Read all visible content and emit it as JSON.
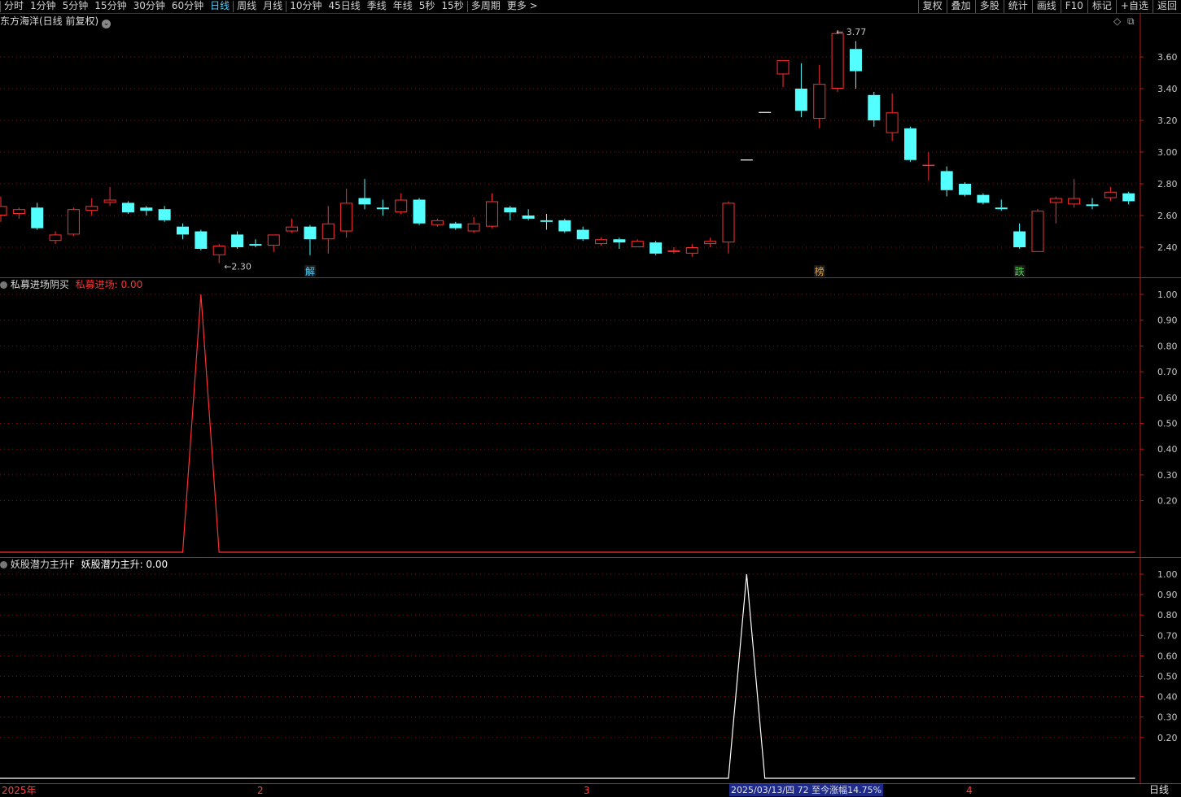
{
  "toolbar": {
    "periods": [
      {
        "label": "分时"
      },
      {
        "label": "1分钟"
      },
      {
        "label": "5分钟"
      },
      {
        "label": "15分钟"
      },
      {
        "label": "30分钟"
      },
      {
        "label": "60分钟"
      },
      {
        "label": "日线",
        "active": true
      },
      {
        "label": "周线"
      },
      {
        "label": "月线"
      },
      {
        "label": "10分钟"
      },
      {
        "label": "45日线"
      },
      {
        "label": "季线"
      },
      {
        "label": "年线"
      },
      {
        "label": "5秒"
      },
      {
        "label": "15秒"
      },
      {
        "label": "多周期"
      },
      {
        "label": "更多 >"
      }
    ],
    "tools": [
      "复权",
      "叠加",
      "多股",
      "统计",
      "画线",
      "F10",
      "标记",
      "+自选",
      "返回"
    ]
  },
  "main_chart": {
    "title": "东方海洋(日线 前复权)",
    "high_label": "3.77",
    "low_label": "2.30",
    "markers": [
      {
        "text": "解",
        "color": "#4fd2ff"
      },
      {
        "text": "榜",
        "color": "#e8a040"
      },
      {
        "text": "跌",
        "color": "#4fd24f"
      }
    ],
    "y_ticks": [
      "3.60",
      "3.40",
      "3.20",
      "3.00",
      "2.80",
      "2.60",
      "2.40"
    ]
  },
  "indicator1": {
    "name": "私募进场阴买",
    "value_label": "私募进场: 0.00",
    "color": "#ff3030",
    "y_ticks": [
      "1.00",
      "0.90",
      "0.80",
      "0.70",
      "0.60",
      "0.50",
      "0.40",
      "0.30",
      "0.20"
    ]
  },
  "indicator2": {
    "name": "妖股潜力主升F",
    "value_label": "妖股潜力主升: 0.00",
    "color": "#ffffff",
    "y_ticks": [
      "1.00",
      "0.90",
      "0.80",
      "0.70",
      "0.60",
      "0.50",
      "0.40",
      "0.30",
      "0.20"
    ]
  },
  "bottom": {
    "x_labels": [
      "2025年",
      "2",
      "3",
      "4"
    ],
    "status_text": "2025/03/13/四 72 至今涨幅14.75%",
    "period_label": "日线"
  },
  "colors": {
    "up": "#ff3030",
    "down": "#54ffff",
    "grid": "#8b1010",
    "frame": "#c01818",
    "text": "#c8c8c8"
  },
  "chart_data": {
    "type": "candlestick",
    "price_range": [
      2.2,
      3.8
    ],
    "candles": [
      {
        "o": 2.6,
        "c": 2.66,
        "h": 2.72,
        "l": 2.56
      },
      {
        "o": 2.61,
        "c": 2.64,
        "h": 2.65,
        "l": 2.58
      },
      {
        "o": 2.65,
        "c": 2.52,
        "h": 2.68,
        "l": 2.51
      },
      {
        "o": 2.44,
        "c": 2.48,
        "h": 2.5,
        "l": 2.42
      },
      {
        "o": 2.48,
        "c": 2.64,
        "h": 2.65,
        "l": 2.47
      },
      {
        "o": 2.63,
        "c": 2.66,
        "h": 2.71,
        "l": 2.6
      },
      {
        "o": 2.68,
        "c": 2.7,
        "h": 2.78,
        "l": 2.66
      },
      {
        "o": 2.68,
        "c": 2.62,
        "h": 2.69,
        "l": 2.61
      },
      {
        "o": 2.65,
        "c": 2.63,
        "h": 2.66,
        "l": 2.6
      },
      {
        "o": 2.64,
        "c": 2.57,
        "h": 2.66,
        "l": 2.56
      },
      {
        "o": 2.53,
        "c": 2.48,
        "h": 2.55,
        "l": 2.45
      },
      {
        "o": 2.5,
        "c": 2.39,
        "h": 2.51,
        "l": 2.38
      },
      {
        "o": 2.35,
        "c": 2.41,
        "h": 2.42,
        "l": 2.3
      },
      {
        "o": 2.48,
        "c": 2.4,
        "h": 2.5,
        "l": 2.39
      },
      {
        "o": 2.42,
        "c": 2.41,
        "h": 2.45,
        "l": 2.4
      },
      {
        "o": 2.41,
        "c": 2.48,
        "h": 2.48,
        "l": 2.37
      },
      {
        "o": 2.5,
        "c": 2.53,
        "h": 2.58,
        "l": 2.49
      },
      {
        "o": 2.53,
        "c": 2.45,
        "h": 2.54,
        "l": 2.35
      },
      {
        "o": 2.45,
        "c": 2.55,
        "h": 2.66,
        "l": 2.36
      },
      {
        "o": 2.5,
        "c": 2.68,
        "h": 2.77,
        "l": 2.46
      },
      {
        "o": 2.71,
        "c": 2.67,
        "h": 2.83,
        "l": 2.64
      },
      {
        "o": 2.65,
        "c": 2.64,
        "h": 2.7,
        "l": 2.6
      },
      {
        "o": 2.62,
        "c": 2.7,
        "h": 2.74,
        "l": 2.61
      },
      {
        "o": 2.7,
        "c": 2.55,
        "h": 2.71,
        "l": 2.54
      },
      {
        "o": 2.54,
        "c": 2.57,
        "h": 2.58,
        "l": 2.53
      },
      {
        "o": 2.55,
        "c": 2.52,
        "h": 2.56,
        "l": 2.51
      },
      {
        "o": 2.5,
        "c": 2.55,
        "h": 2.59,
        "l": 2.49
      },
      {
        "o": 2.53,
        "c": 2.69,
        "h": 2.74,
        "l": 2.52
      },
      {
        "o": 2.65,
        "c": 2.62,
        "h": 2.66,
        "l": 2.57
      },
      {
        "o": 2.6,
        "c": 2.58,
        "h": 2.64,
        "l": 2.57
      },
      {
        "o": 2.57,
        "c": 2.56,
        "h": 2.61,
        "l": 2.51
      },
      {
        "o": 2.57,
        "c": 2.5,
        "h": 2.58,
        "l": 2.49
      },
      {
        "o": 2.51,
        "c": 2.45,
        "h": 2.53,
        "l": 2.44
      },
      {
        "o": 2.42,
        "c": 2.45,
        "h": 2.46,
        "l": 2.41
      },
      {
        "o": 2.45,
        "c": 2.43,
        "h": 2.46,
        "l": 2.39
      },
      {
        "o": 2.4,
        "c": 2.44,
        "h": 2.45,
        "l": 2.4
      },
      {
        "o": 2.43,
        "c": 2.36,
        "h": 2.44,
        "l": 2.35
      },
      {
        "o": 2.37,
        "c": 2.38,
        "h": 2.4,
        "l": 2.36
      },
      {
        "o": 2.36,
        "c": 2.4,
        "h": 2.42,
        "l": 2.34
      },
      {
        "o": 2.42,
        "c": 2.44,
        "h": 2.46,
        "l": 2.4
      },
      {
        "o": 2.43,
        "c": 2.68,
        "h": 2.69,
        "l": 2.36
      },
      {
        "o": 2.95,
        "c": 2.95,
        "h": 2.95,
        "l": 2.95
      },
      {
        "o": 3.25,
        "c": 3.25,
        "h": 3.25,
        "l": 3.25
      },
      {
        "o": 3.49,
        "c": 3.58,
        "h": 3.58,
        "l": 3.41
      },
      {
        "o": 3.4,
        "c": 3.26,
        "h": 3.56,
        "l": 3.22
      },
      {
        "o": 3.21,
        "c": 3.43,
        "h": 3.55,
        "l": 3.15
      },
      {
        "o": 3.4,
        "c": 3.75,
        "h": 3.77,
        "l": 3.38
      },
      {
        "o": 3.65,
        "c": 3.51,
        "h": 3.7,
        "l": 3.4
      },
      {
        "o": 3.36,
        "c": 3.2,
        "h": 3.38,
        "l": 3.16
      },
      {
        "o": 3.12,
        "c": 3.25,
        "h": 3.37,
        "l": 3.07
      },
      {
        "o": 3.15,
        "c": 2.95,
        "h": 3.16,
        "l": 2.94
      },
      {
        "o": 2.92,
        "c": 2.92,
        "h": 3.0,
        "l": 2.82
      },
      {
        "o": 2.88,
        "c": 2.76,
        "h": 2.91,
        "l": 2.72
      },
      {
        "o": 2.8,
        "c": 2.73,
        "h": 2.81,
        "l": 2.72
      },
      {
        "o": 2.73,
        "c": 2.68,
        "h": 2.74,
        "l": 2.67
      },
      {
        "o": 2.65,
        "c": 2.64,
        "h": 2.7,
        "l": 2.63
      },
      {
        "o": 2.5,
        "c": 2.4,
        "h": 2.55,
        "l": 2.39
      },
      {
        "o": 2.37,
        "c": 2.63,
        "h": 2.64,
        "l": 2.37
      },
      {
        "o": 2.68,
        "c": 2.71,
        "h": 2.72,
        "l": 2.55
      },
      {
        "o": 2.67,
        "c": 2.71,
        "h": 2.83,
        "l": 2.65
      },
      {
        "o": 2.67,
        "c": 2.66,
        "h": 2.71,
        "l": 2.64
      },
      {
        "o": 2.71,
        "c": 2.75,
        "h": 2.78,
        "l": 2.69
      },
      {
        "o": 2.74,
        "c": 2.69,
        "h": 2.75,
        "l": 2.67
      }
    ],
    "indicator1_series": {
      "peak_index": 11,
      "peak": 1.0,
      "base": 0.0
    },
    "indicator2_series": {
      "peak_index": 41,
      "peak": 1.0,
      "base": 0.0
    },
    "indicator_range": [
      0,
      1.0
    ]
  }
}
